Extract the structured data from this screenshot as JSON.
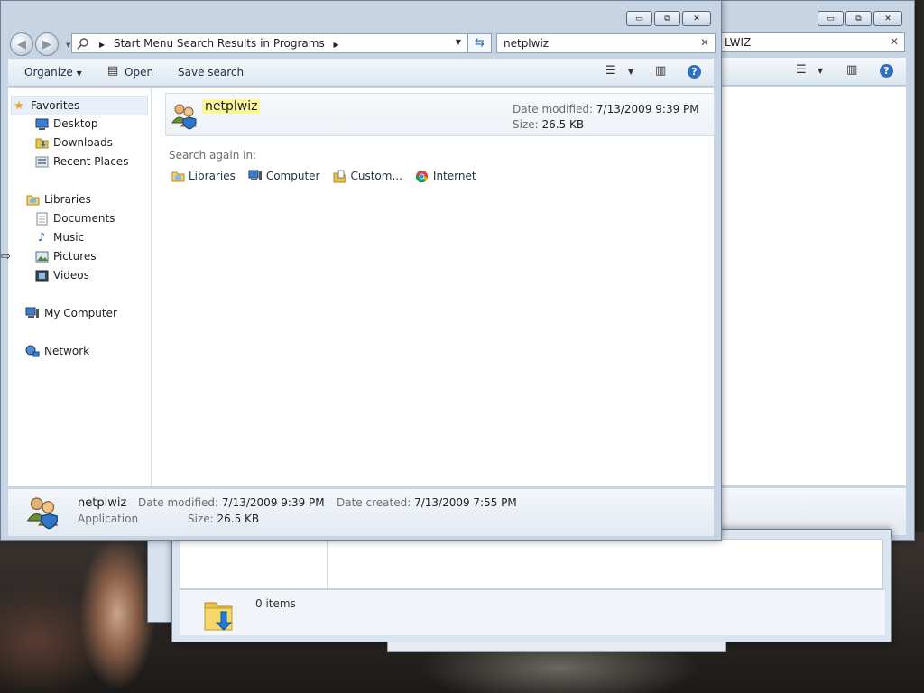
{
  "window": {
    "caption": {
      "minimize": "▭",
      "maximize": "⧉",
      "close": "✕"
    },
    "address": {
      "crumb1": "Start Menu",
      "crumb2": "Search Results in Programs"
    },
    "search": {
      "value": "netplwiz",
      "clear": "✕"
    },
    "back_search": {
      "value": "LWIZ",
      "clear": "✕"
    },
    "toolbar": {
      "organize": "Organize",
      "open": "Open",
      "save_search": "Save search",
      "help": "?"
    },
    "nav": {
      "favorites": "Favorites",
      "desktop": "Desktop",
      "downloads": "Downloads",
      "recent_places": "Recent Places",
      "libraries": "Libraries",
      "documents": "Documents",
      "music": "Music",
      "pictures": "Pictures",
      "videos": "Videos",
      "my_computer": "My Computer",
      "network": "Network"
    },
    "result": {
      "name": "netplwiz",
      "date_label": "Date modified:",
      "date_value": "7/13/2009 9:39 PM",
      "size_label": "Size:",
      "size_value": "26.5 KB"
    },
    "search_again": {
      "label": "Search again in:",
      "links": [
        "Libraries",
        "Computer",
        "Custom...",
        "Internet"
      ]
    },
    "details": {
      "name": "netplwiz",
      "type": "Application",
      "modified_label": "Date modified:",
      "modified_value": "7/13/2009 9:39 PM",
      "size_label": "Size:",
      "size_value": "26.5 KB",
      "created_label": "Date created:",
      "created_value": "7/13/2009 7:55 PM"
    }
  },
  "lower_window": {
    "items_count": "0 items"
  },
  "colors": {
    "glass": "#c7d4e4",
    "highlight": "#fbf69a",
    "link": "#1e3048"
  }
}
